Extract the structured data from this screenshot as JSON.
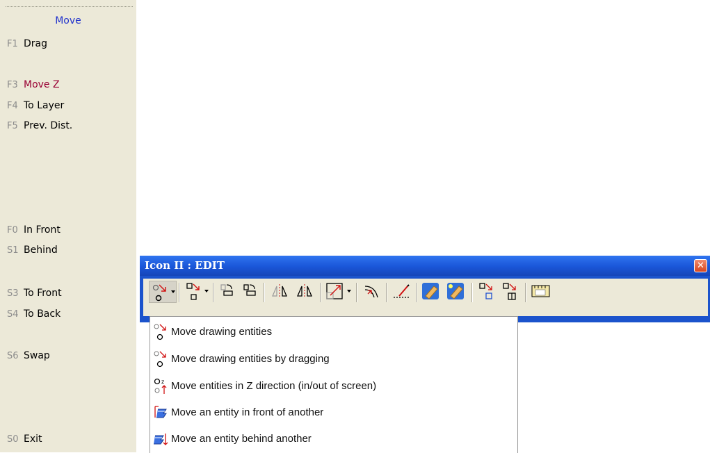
{
  "side_panel": {
    "title": "Move",
    "items": [
      {
        "key": "F1",
        "label": "Drag"
      },
      {
        "key": "F3",
        "label": "Move Z"
      },
      {
        "key": "F4",
        "label": "To Layer"
      },
      {
        "key": "F5",
        "label": "Prev. Dist."
      },
      {
        "key": "F0",
        "label": "In Front"
      },
      {
        "key": "S1",
        "label": "Behind"
      },
      {
        "key": "S3",
        "label": "To Front"
      },
      {
        "key": "S4",
        "label": "To Back"
      },
      {
        "key": "S6",
        "label": "Swap"
      },
      {
        "key": "S0",
        "label": "Exit"
      }
    ]
  },
  "toolbar": {
    "title": "Icon II : EDIT",
    "close_glyph": "✕",
    "buttons": [
      {
        "name": "move-entities-dropdown",
        "icon": "move-icon"
      },
      {
        "name": "copy-entities-dropdown",
        "icon": "copy-icon"
      },
      {
        "name": "rotate-button",
        "icon": "rotate-icon"
      },
      {
        "name": "rotate-copy-button",
        "icon": "rotate-copy-icon"
      },
      {
        "name": "mirror-button",
        "icon": "mirror-icon"
      },
      {
        "name": "mirror-copy-button",
        "icon": "mirror-copy-icon"
      },
      {
        "name": "scale-dropdown",
        "icon": "scale-icon"
      },
      {
        "name": "offset-button",
        "icon": "offset-icon"
      },
      {
        "name": "trim-button",
        "icon": "trim-icon"
      },
      {
        "name": "erase-button",
        "icon": "eraser-icon"
      },
      {
        "name": "erase-all-button",
        "icon": "eraser-star-icon"
      },
      {
        "name": "array-button",
        "icon": "array-icon"
      },
      {
        "name": "array-copy-button",
        "icon": "array-copy-icon"
      },
      {
        "name": "measure-button",
        "icon": "ruler-icon"
      }
    ]
  },
  "menu": {
    "items": [
      {
        "label": "Move drawing entities",
        "icon": "move-entities-icon"
      },
      {
        "label": "Move drawing entities by dragging",
        "icon": "drag-entities-icon"
      },
      {
        "label": "Move entities in Z direction (in/out of screen)",
        "icon": "move-z-icon"
      },
      {
        "label": "Move an entity in front of another",
        "icon": "in-front-icon"
      },
      {
        "label": "Move an entity behind another",
        "icon": "behind-icon"
      }
    ]
  },
  "colors": {
    "panel_bg": "#ece9d8",
    "panel_title": "#2233cc",
    "active_item": "#990033",
    "titlebar": "#1a56d8"
  }
}
